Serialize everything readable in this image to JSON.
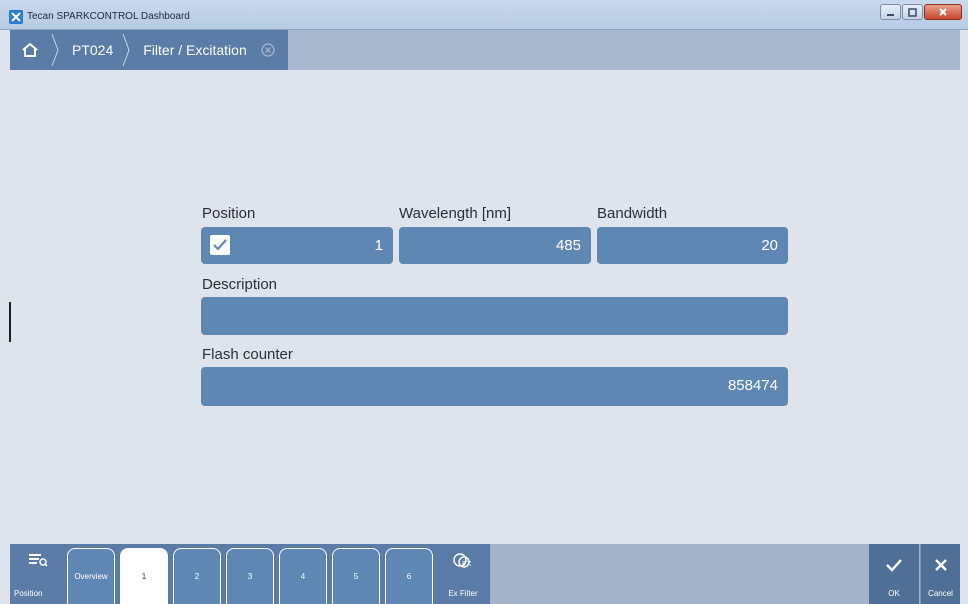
{
  "window": {
    "title": "Tecan SPARKCONTROL Dashboard"
  },
  "breadcrumb": {
    "items": [
      "PT024",
      "Filter / Excitation"
    ]
  },
  "form": {
    "position_label": "Position",
    "position_value": "1",
    "position_checked": true,
    "wavelength_label": "Wavelength [nm]",
    "wavelength_value": "485",
    "bandwidth_label": "Bandwidth",
    "bandwidth_value": "20",
    "description_label": "Description",
    "description_value": "",
    "flash_label": "Flash counter",
    "flash_value": "858474"
  },
  "toolbar": {
    "position_label": "Position",
    "tabs": [
      "Overview",
      "1",
      "2",
      "3",
      "4",
      "5",
      "6"
    ],
    "active_tab": "1",
    "exfilter_label": "Ex Filter",
    "ok_label": "OK",
    "cancel_label": "Cancel"
  },
  "colors": {
    "accent": "#5f87b3",
    "header": "#5a7ca6",
    "background": "#dfe3ec"
  }
}
